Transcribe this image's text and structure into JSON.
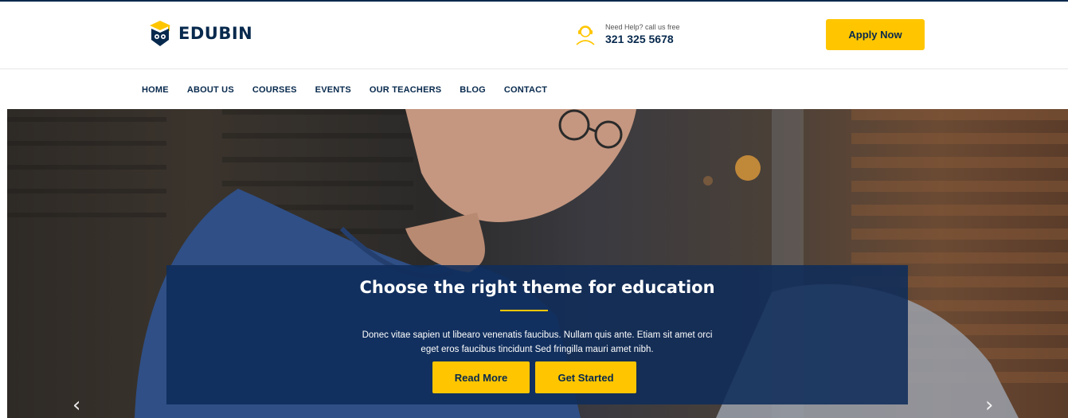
{
  "brand": {
    "name": "EDUBIN",
    "logo_icon": "graduation-owl-logo"
  },
  "help": {
    "label": "Need Help? call us free",
    "phone": "321 325 5678",
    "icon": "headset-support-icon"
  },
  "header": {
    "apply_label": "Apply Now"
  },
  "nav": {
    "items": [
      "HOME",
      "ABOUT US",
      "COURSES",
      "EVENTS",
      "OUR TEACHERS",
      "BLOG",
      "CONTACT"
    ]
  },
  "hero": {
    "title": "Choose the right theme for education",
    "text": "Donec vitae sapien ut libearo venenatis faucibus. Nullam quis ante. Etiam sit amet orci eget eros faucibus tincidunt Sed fringilla mauri amet nibh.",
    "read_more_label": "Read More",
    "get_started_label": "Get Started",
    "prev_arrow": "‹",
    "next_arrow": "›"
  },
  "colors": {
    "navy": "#07294d",
    "accent": "#ffc600",
    "overlay": "#0f2c5a"
  }
}
